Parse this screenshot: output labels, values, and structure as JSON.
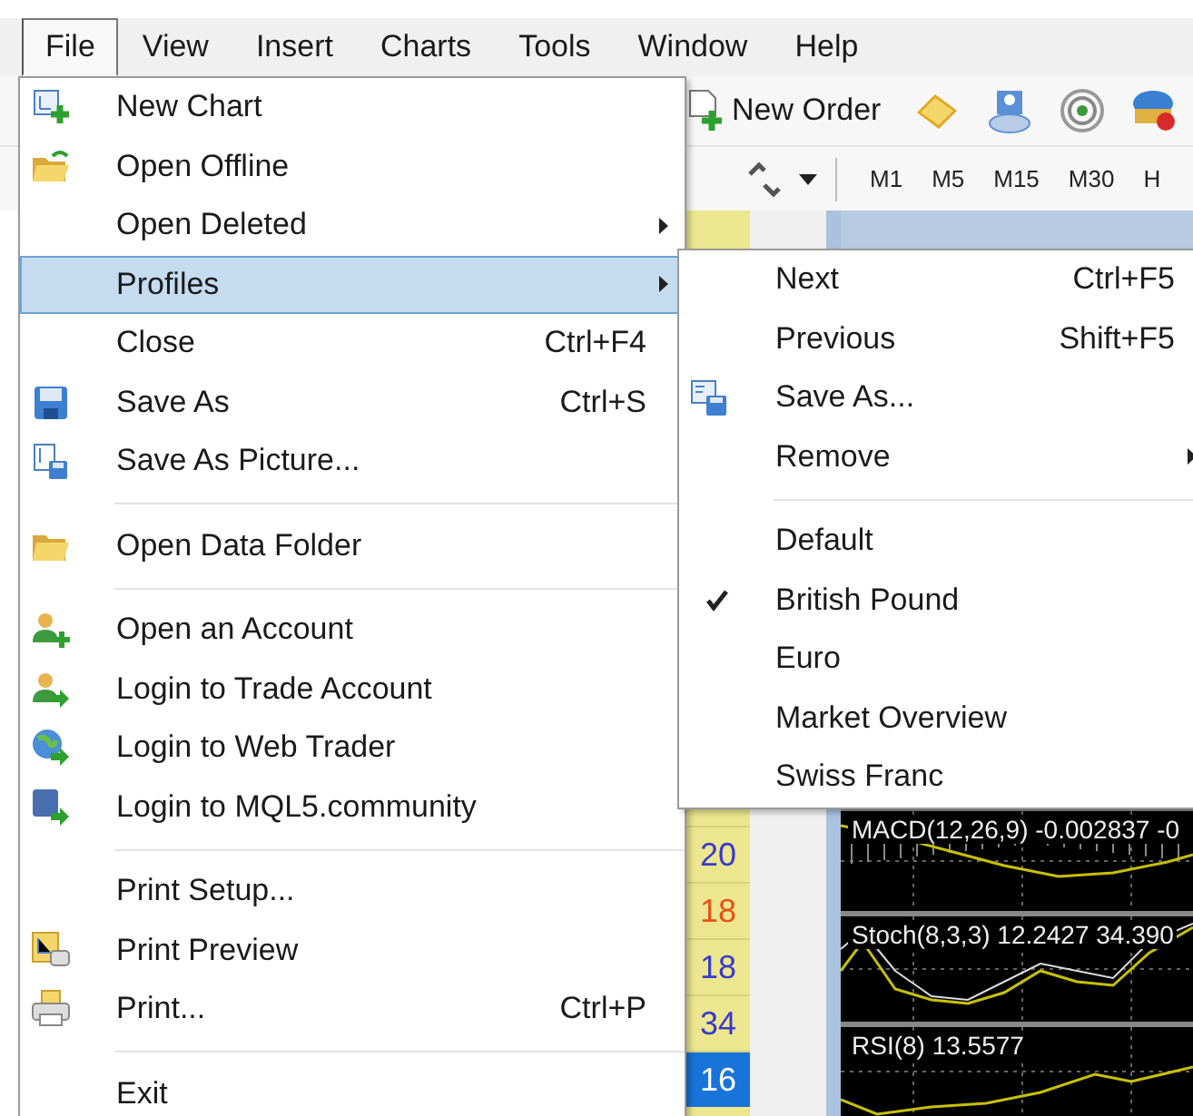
{
  "menu_bar": {
    "items": [
      {
        "label": "File",
        "selected": true
      },
      {
        "label": "View",
        "selected": false
      },
      {
        "label": "Insert",
        "selected": false
      },
      {
        "label": "Charts",
        "selected": false
      },
      {
        "label": "Tools",
        "selected": false
      },
      {
        "label": "Window",
        "selected": false
      },
      {
        "label": "Help",
        "selected": false
      }
    ]
  },
  "toolbar": {
    "new_order": "New Order",
    "timeframes": [
      "M1",
      "M5",
      "M15",
      "M30",
      "H"
    ]
  },
  "file_menu": {
    "items": [
      {
        "kind": "item",
        "label": "New Chart",
        "selected": false,
        "submenu": false
      },
      {
        "kind": "item",
        "label": "Open Offline",
        "selected": false,
        "submenu": false
      },
      {
        "kind": "item",
        "label": "Open Deleted",
        "selected": false,
        "submenu": true
      },
      {
        "kind": "item",
        "label": "Profiles",
        "selected": true,
        "submenu": true
      },
      {
        "kind": "item",
        "label": "Close",
        "shortcut": "Ctrl+F4",
        "selected": false,
        "submenu": false
      },
      {
        "kind": "item",
        "label": "Save As",
        "shortcut": "Ctrl+S",
        "selected": false,
        "submenu": false
      },
      {
        "kind": "item",
        "label": "Save As Picture...",
        "selected": false,
        "submenu": false
      },
      {
        "kind": "separator"
      },
      {
        "kind": "item",
        "label": "Open Data Folder",
        "selected": false,
        "submenu": false
      },
      {
        "kind": "separator"
      },
      {
        "kind": "item",
        "label": "Open an Account",
        "selected": false,
        "submenu": false
      },
      {
        "kind": "item",
        "label": "Login to Trade Account",
        "selected": false,
        "submenu": false
      },
      {
        "kind": "item",
        "label": "Login to Web Trader",
        "selected": false,
        "submenu": false
      },
      {
        "kind": "item",
        "label": "Login to MQL5.community",
        "selected": false,
        "submenu": false
      },
      {
        "kind": "separator"
      },
      {
        "kind": "item",
        "label": "Print Setup...",
        "selected": false,
        "submenu": false
      },
      {
        "kind": "item",
        "label": "Print Preview",
        "selected": false,
        "submenu": false
      },
      {
        "kind": "item",
        "label": "Print...",
        "shortcut": "Ctrl+P",
        "selected": false,
        "submenu": false
      },
      {
        "kind": "separator"
      },
      {
        "kind": "item",
        "label": "Exit",
        "selected": false,
        "submenu": false
      }
    ]
  },
  "profiles_menu": {
    "items": [
      {
        "kind": "item",
        "label": "Next",
        "shortcut": "Ctrl+F5",
        "checked": false,
        "submenu": false
      },
      {
        "kind": "item",
        "label": "Previous",
        "shortcut": "Shift+F5",
        "checked": false,
        "submenu": false
      },
      {
        "kind": "item",
        "label": "Save As...",
        "checked": false,
        "submenu": false
      },
      {
        "kind": "item",
        "label": "Remove",
        "checked": false,
        "submenu": true
      },
      {
        "kind": "separator"
      },
      {
        "kind": "item",
        "label": "Default",
        "checked": false,
        "submenu": false
      },
      {
        "kind": "item",
        "label": "British Pound",
        "checked": true,
        "submenu": false
      },
      {
        "kind": "item",
        "label": "Euro",
        "checked": false,
        "submenu": false
      },
      {
        "kind": "item",
        "label": "Market Overview",
        "checked": false,
        "submenu": false
      },
      {
        "kind": "item",
        "label": "Swiss Franc",
        "checked": false,
        "submenu": false
      }
    ]
  },
  "number_column": [
    {
      "value": "20",
      "color": "#3a3acc",
      "selected": false
    },
    {
      "value": "18",
      "color": "#e8501a",
      "selected": false
    },
    {
      "value": "18",
      "color": "#3a3acc",
      "selected": false
    },
    {
      "value": "34",
      "color": "#3a3acc",
      "selected": false
    },
    {
      "value": "16",
      "selected": true
    }
  ],
  "indicators": [
    {
      "label": "MACD(12,26,9) -0.002837 -0"
    },
    {
      "label": "Stoch(8,3,3) 12.2427 34.390"
    },
    {
      "label": "RSI(8) 13.5577"
    }
  ]
}
